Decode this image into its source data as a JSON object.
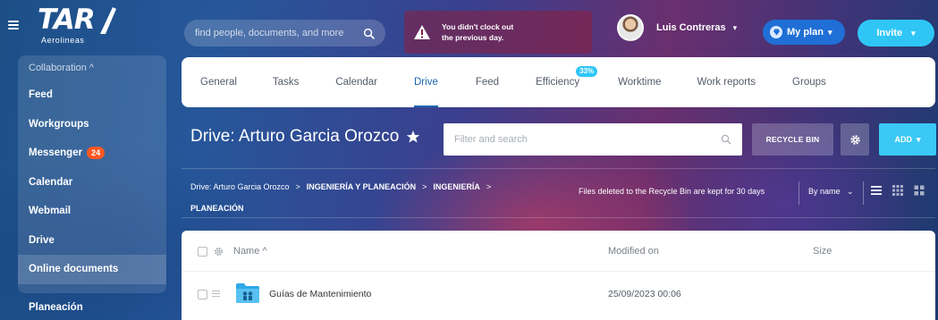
{
  "app": {
    "logo_main": "TAR",
    "logo_sub": "Aerolineas"
  },
  "header": {
    "search_placeholder": "find people, documents, and more",
    "alert_text": "You didn't clock out\nthe previous day.",
    "user_name": "Luis Contreras",
    "plan_label": "My plan",
    "invite_label": "Invite"
  },
  "sidebar": {
    "group_label": "Collaboration ^",
    "items": [
      {
        "label": "Feed"
      },
      {
        "label": "Workgroups"
      },
      {
        "label": "Messenger",
        "badge": "24"
      },
      {
        "label": "Calendar"
      },
      {
        "label": "Webmail"
      },
      {
        "label": "Drive"
      },
      {
        "label": "Online documents"
      }
    ],
    "after_group": "Planeación"
  },
  "tabs": [
    {
      "label": "General"
    },
    {
      "label": "Tasks"
    },
    {
      "label": "Calendar"
    },
    {
      "label": "Drive"
    },
    {
      "label": "Feed"
    },
    {
      "label": "Efficiency",
      "pill": "33%"
    },
    {
      "label": "Worktime"
    },
    {
      "label": "Work reports"
    },
    {
      "label": "Groups"
    }
  ],
  "active_tab": "Drive",
  "page": {
    "title": "Drive: Arturo Garcia Orozco",
    "filter_placeholder": "Filter and search",
    "recycle_bin": "RECYCLE BIN",
    "add_label": "ADD"
  },
  "breadcrumb": {
    "items": [
      "Drive: Arturo Garcia Orozco",
      "INGENIERÍA Y PLANEACIÓN",
      "INGENIERÍA",
      "PLANEACIÓN"
    ],
    "separator": ">",
    "recycle_note": "Files deleted to the Recycle Bin are kept for 30 days",
    "sort_label": "By name"
  },
  "table": {
    "columns": {
      "name": "Name ^",
      "modified": "Modified on",
      "size": "Size"
    },
    "rows": [
      {
        "name": "Guías de Mantenimiento",
        "modified": "25/09/2023 00:06",
        "size": ""
      }
    ]
  },
  "colors": {
    "accent": "#2067b0",
    "add_button": "#3bc8f5",
    "invite_button": "#2fc6f6",
    "plan_button": "#1f6fd6",
    "badge": "#ff5722",
    "folder": "#2fa8e8"
  }
}
